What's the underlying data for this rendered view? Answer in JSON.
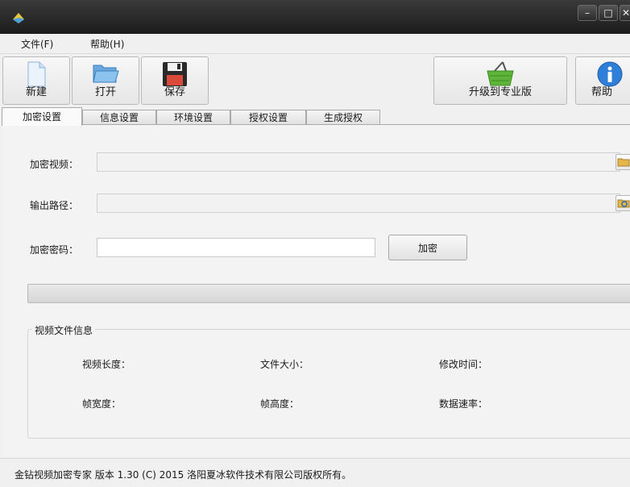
{
  "titlebar": {
    "min": "–",
    "max": "□",
    "close": "✕"
  },
  "menu": [
    {
      "label": "文件(F)"
    },
    {
      "label": "帮助(H)"
    }
  ],
  "toolbar": {
    "new": "新建",
    "open": "打开",
    "save": "保存",
    "upgrade": "升级到专业版",
    "help": "帮助"
  },
  "tabs": [
    {
      "label": "加密设置",
      "active": true
    },
    {
      "label": "信息设置"
    },
    {
      "label": "环境设置"
    },
    {
      "label": "授权设置"
    },
    {
      "label": "生成授权"
    }
  ],
  "form": {
    "video_label": "加密视频：",
    "video_value": "",
    "output_label": "输出路径：",
    "output_value": "",
    "password_label": "加密密码：",
    "password_value": "",
    "encrypt_button": "加密",
    "progress": 0
  },
  "info": {
    "title": "视频文件信息",
    "duration": "视频长度：",
    "file_size": "文件大小：",
    "modified": "修改时间：",
    "frame_width": "帧宽度：",
    "frame_height": "帧高度：",
    "data_rate": "数据速率："
  },
  "status": "金钻视频加密专家  版本 1.30 (C)  2015 洛阳夏冰软件技术有限公司版权所有。",
  "colors": {
    "titlebar": "#1c1c1c",
    "basket": "#5fb53a",
    "help_icon": "#2f7fd8"
  }
}
